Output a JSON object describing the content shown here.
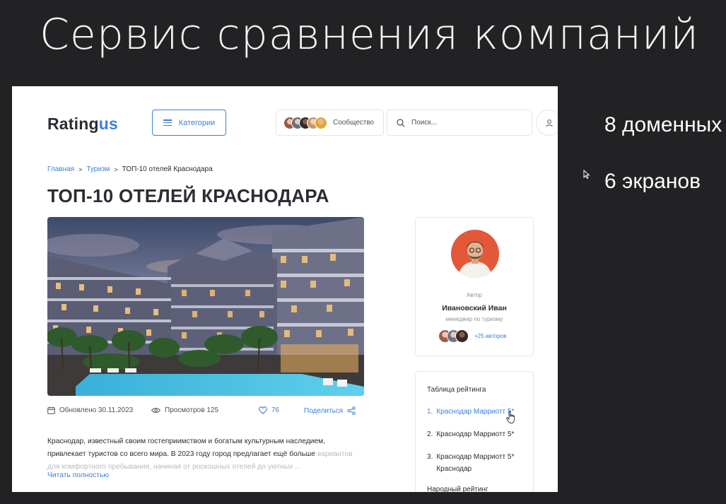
{
  "slide": {
    "title": "Сервис сравнения компаний",
    "notes": [
      "8 доменных",
      "6 экранов"
    ]
  },
  "header": {
    "logo_main": "Rating",
    "logo_accent": "us",
    "categories_label": "Категории",
    "community_label": "Сообщество",
    "search_placeholder": "Поиск..."
  },
  "breadcrumb": {
    "items": [
      "Главная",
      "Туризм"
    ],
    "current": "ТОП-10 отелей Краснодара"
  },
  "page_title": "ТОП-10 ОТЕЛЕЙ КРАСНОДАРА",
  "meta": {
    "updated": "Обновлено 30.11.2023",
    "views": "Просмотров 125",
    "likes": "76",
    "share": "Поделиться"
  },
  "article": {
    "text": "Краснодар, известный своим гостеприимством и богатым культурным наследием, привлекает туристов со всего мира. В 2023 году город предлагает ещё больше",
    "faded": "вариантов для комфортного пребывания, начиная от роскошных отелей до уютных ...",
    "read_more": "Читать полностью"
  },
  "author": {
    "role_label": "Автор",
    "name": "Ивановский Иван",
    "position": "менеджер по туризму",
    "more_authors": "+25 авторов"
  },
  "rating_table": {
    "title": "Таблица рейтинга",
    "items": [
      {
        "num": "1.",
        "label": "Краснодар Марриотт 5*"
      },
      {
        "num": "2.",
        "label": "Краснодар Марриотт 5*"
      },
      {
        "num": "3.",
        "label": "Краснодар Марриотт 5* Краснодар"
      }
    ],
    "footer": "Народный рейтинг"
  },
  "colors": {
    "accent": "#3f7fd6",
    "text": "#2a2d33",
    "slide_bg": "#222124"
  }
}
